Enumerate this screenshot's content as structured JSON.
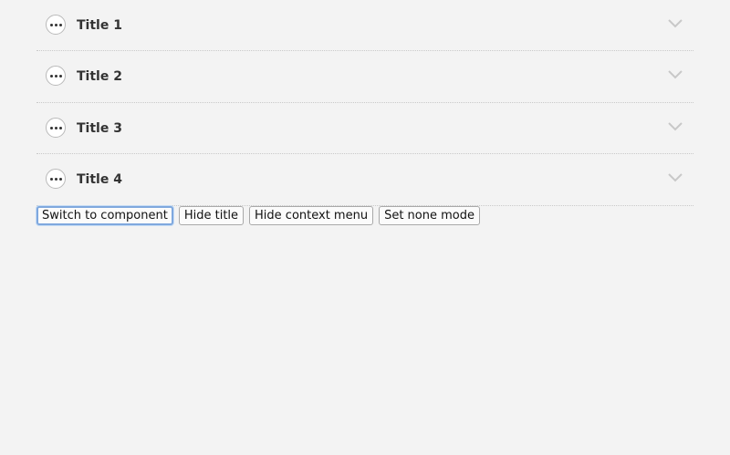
{
  "accordion": {
    "items": [
      {
        "title": "Title 1",
        "context_icon": "more-horizontal-icon",
        "toggle_icon": "chevron-down-icon"
      },
      {
        "title": "Title 2",
        "context_icon": "more-horizontal-icon",
        "toggle_icon": "chevron-down-icon"
      },
      {
        "title": "Title 3",
        "context_icon": "more-horizontal-icon",
        "toggle_icon": "chevron-down-icon"
      },
      {
        "title": "Title 4",
        "context_icon": "more-horizontal-icon",
        "toggle_icon": "chevron-down-icon"
      }
    ]
  },
  "controls": {
    "switch_label": "Switch to component",
    "hide_title_label": "Hide title",
    "hide_context_label": "Hide context menu",
    "set_none_label": "Set none mode"
  },
  "colors": {
    "background": "#f3f3f3",
    "focus_ring": "#7fa8de",
    "chevron": "#c8c8c8"
  }
}
